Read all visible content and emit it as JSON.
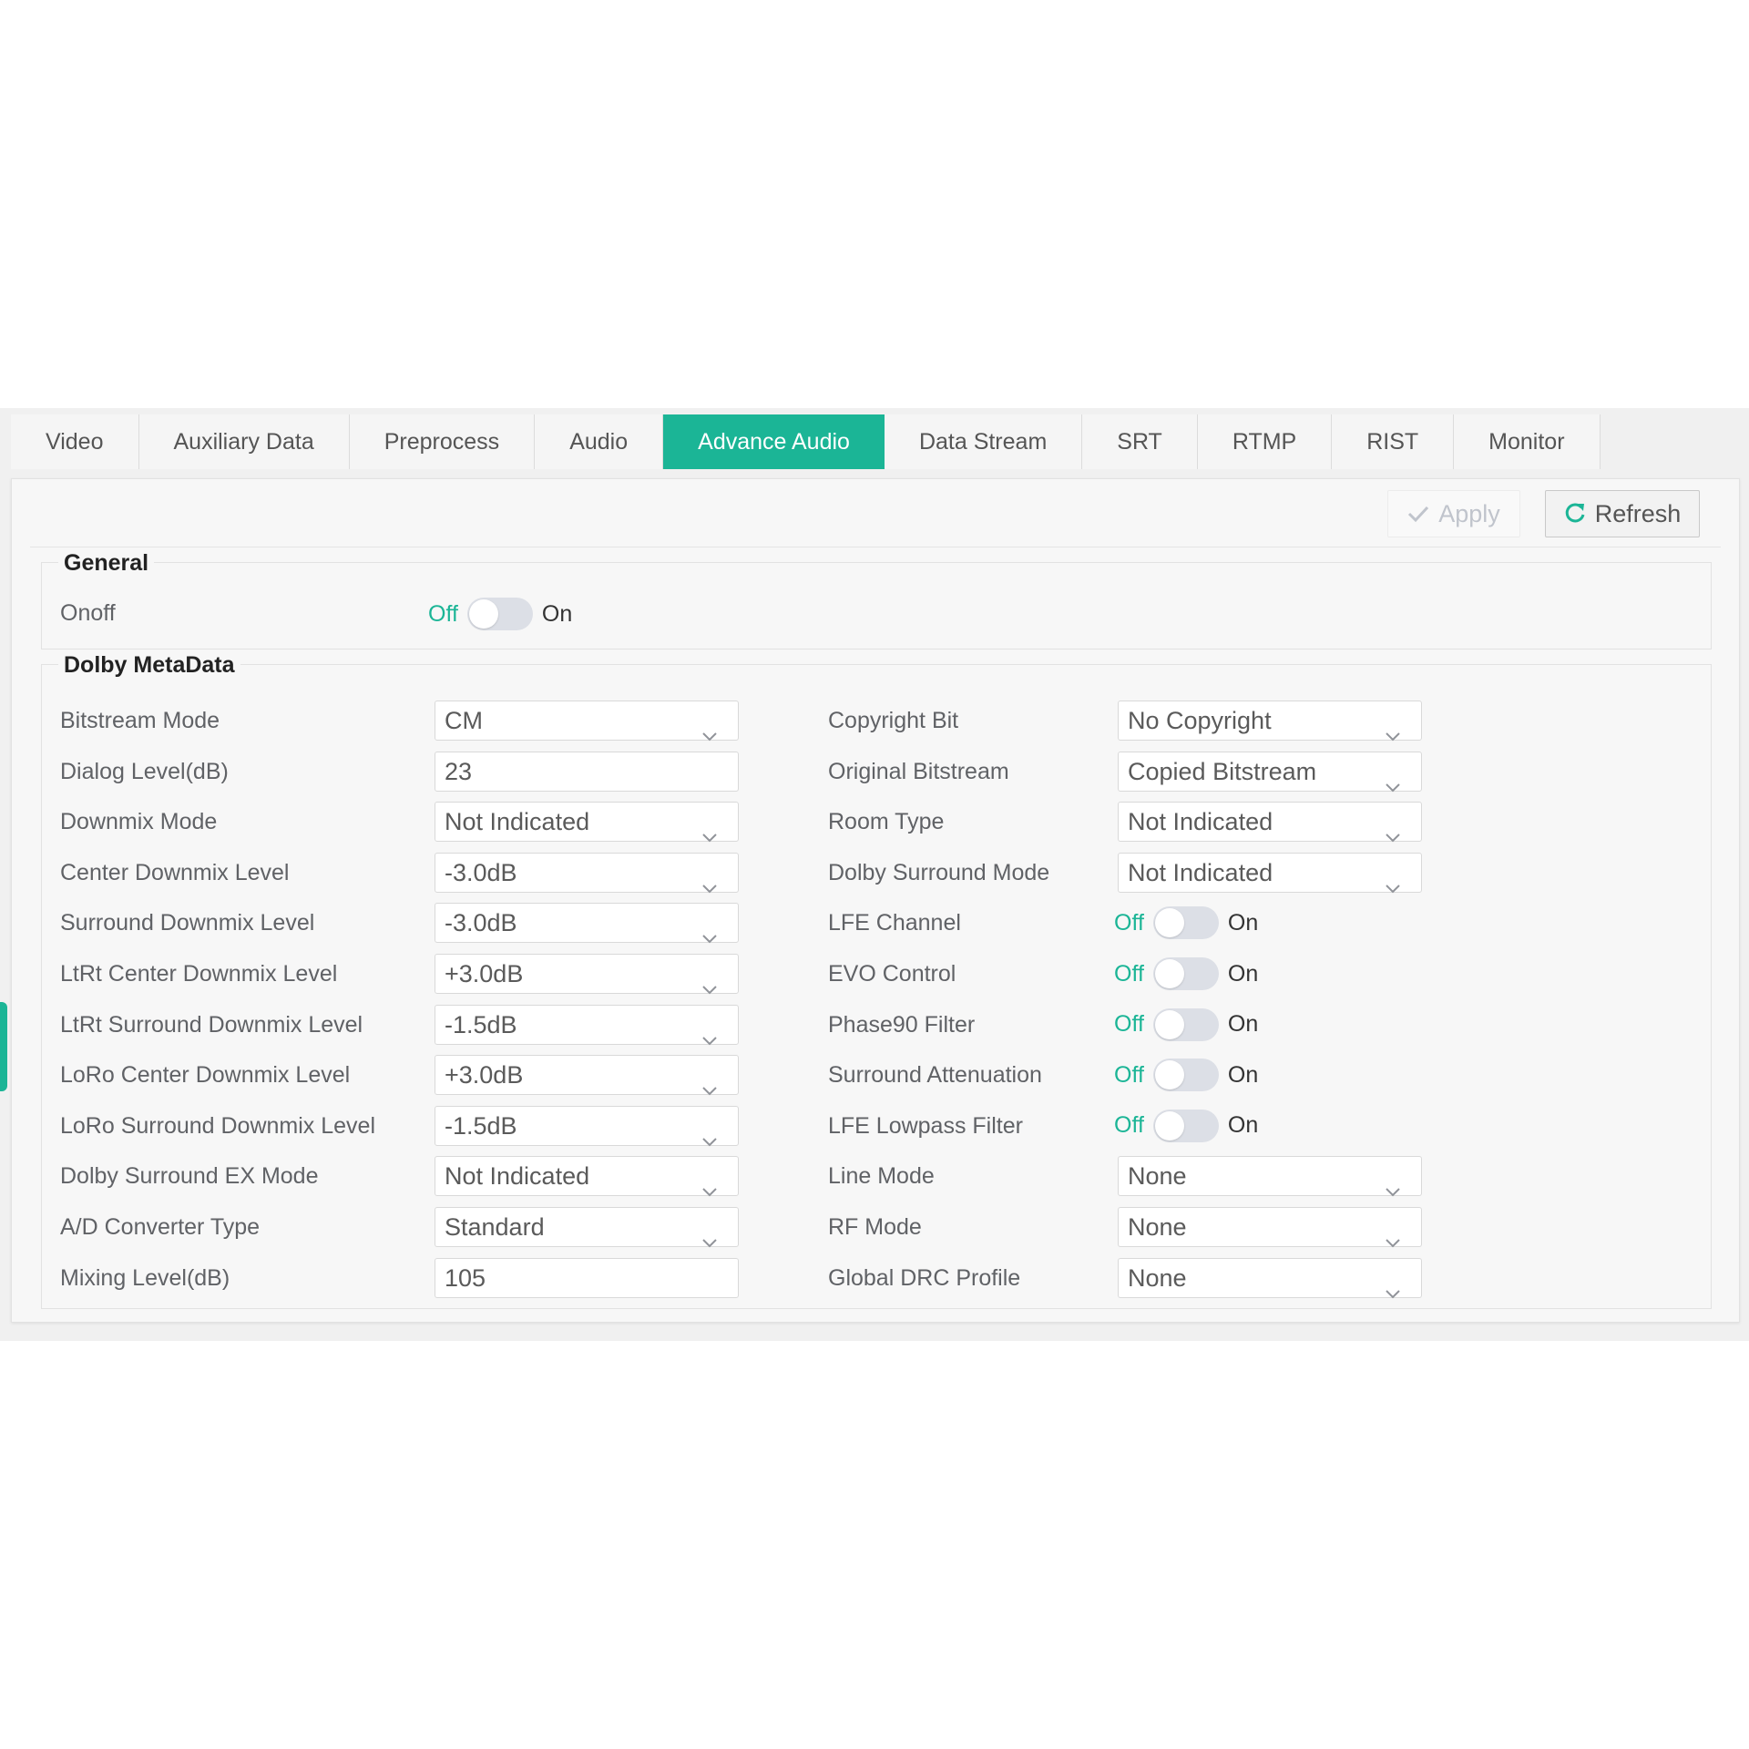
{
  "colors": {
    "accent": "#1bb596",
    "panel_bg": "#f7f7f7",
    "text": "#606266"
  },
  "tabs": [
    {
      "label": "Video"
    },
    {
      "label": "Auxiliary Data"
    },
    {
      "label": "Preprocess"
    },
    {
      "label": "Audio"
    },
    {
      "label": "Advance Audio",
      "active": true
    },
    {
      "label": "Data Stream"
    },
    {
      "label": "SRT"
    },
    {
      "label": "RTMP"
    },
    {
      "label": "RIST"
    },
    {
      "label": "Monitor"
    }
  ],
  "toolbar": {
    "apply_label": "Apply",
    "refresh_label": "Refresh",
    "apply_icon": "check-icon",
    "refresh_icon": "refresh-icon"
  },
  "general": {
    "title": "General",
    "onoff": {
      "label": "Onoff",
      "off": "Off",
      "on": "On",
      "value": false
    }
  },
  "dolby": {
    "title": "Dolby MetaData",
    "left": [
      {
        "label": "Bitstream Mode",
        "type": "select",
        "value": "CM"
      },
      {
        "label": "Dialog Level(dB)",
        "type": "input",
        "value": "23"
      },
      {
        "label": "Downmix Mode",
        "type": "select",
        "value": "Not Indicated"
      },
      {
        "label": "Center Downmix Level",
        "type": "select",
        "value": "-3.0dB"
      },
      {
        "label": "Surround Downmix Level",
        "type": "select",
        "value": "-3.0dB"
      },
      {
        "label": "LtRt Center Downmix Level",
        "type": "select",
        "value": "+3.0dB"
      },
      {
        "label": "LtRt Surround Downmix Level",
        "type": "select",
        "value": "-1.5dB"
      },
      {
        "label": "LoRo Center Downmix Level",
        "type": "select",
        "value": "+3.0dB"
      },
      {
        "label": "LoRo Surround Downmix Level",
        "type": "select",
        "value": "-1.5dB"
      },
      {
        "label": "Dolby Surround EX Mode",
        "type": "select",
        "value": "Not Indicated"
      },
      {
        "label": "A/D Converter Type",
        "type": "select",
        "value": "Standard"
      },
      {
        "label": "Mixing Level(dB)",
        "type": "input",
        "value": "105"
      }
    ],
    "right": [
      {
        "label": "Copyright Bit",
        "type": "select",
        "value": "No Copyright"
      },
      {
        "label": "Original Bitstream",
        "type": "select",
        "value": "Copied Bitstream"
      },
      {
        "label": "Room Type",
        "type": "select",
        "value": "Not Indicated"
      },
      {
        "label": "Dolby Surround Mode",
        "type": "select",
        "value": "Not Indicated"
      },
      {
        "label": "LFE Channel",
        "type": "switch",
        "off": "Off",
        "on": "On",
        "value": false
      },
      {
        "label": "EVO Control",
        "type": "switch",
        "off": "Off",
        "on": "On",
        "value": false
      },
      {
        "label": "Phase90 Filter",
        "type": "switch",
        "off": "Off",
        "on": "On",
        "value": false
      },
      {
        "label": "Surround Attenuation",
        "type": "switch",
        "off": "Off",
        "on": "On",
        "value": false
      },
      {
        "label": "LFE Lowpass Filter",
        "type": "switch",
        "off": "Off",
        "on": "On",
        "value": false
      },
      {
        "label": "Line Mode",
        "type": "select",
        "value": "None"
      },
      {
        "label": "RF Mode",
        "type": "select",
        "value": "None"
      },
      {
        "label": "Global DRC Profile",
        "type": "select",
        "value": "None"
      }
    ]
  }
}
